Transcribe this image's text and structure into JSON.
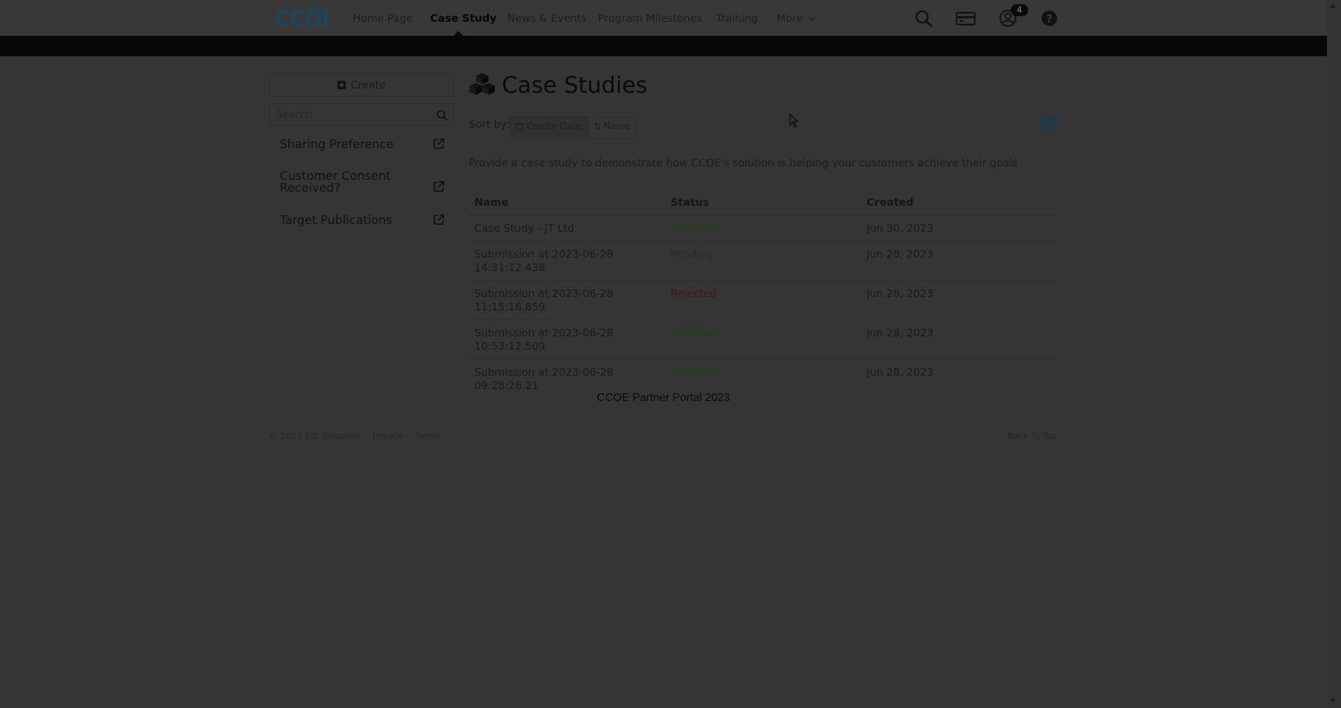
{
  "nav": {
    "logo_text": "CCOE",
    "items": [
      {
        "label": "Home Page"
      },
      {
        "label": "Case Study"
      },
      {
        "label": "News & Events"
      },
      {
        "label": "Program Milestones"
      },
      {
        "label": "Training"
      },
      {
        "label": "More"
      }
    ],
    "active_index": 1,
    "notification_count": "4",
    "icons": [
      "search-icon",
      "card-icon",
      "user-icon",
      "help-icon"
    ]
  },
  "sidebar": {
    "create_label": "Create",
    "search_placeholder": "Search",
    "links": [
      {
        "label": "Sharing Preference"
      },
      {
        "label": "Customer Consent Received?"
      },
      {
        "label": "Target Publications"
      }
    ]
  },
  "main": {
    "title": "Case Studies",
    "sort_label": "Sort by:",
    "sort_options": [
      {
        "label": "Create Date",
        "icon": "calendar-icon"
      },
      {
        "label": "Name",
        "icon": "sort-icon"
      }
    ],
    "sort_active": "Create Date",
    "description": "Provide a case study to demonstrate how CCOE's solution is helping your customers achieve their goals",
    "table": {
      "headers": [
        "Name",
        "Status",
        "Created"
      ],
      "rows": [
        {
          "name": "Case Study - JT Ltd",
          "status": "Approved",
          "created": "Jun 30, 2023"
        },
        {
          "name": "Submission at 2023-06-28 14:31:12.438",
          "status": "Pending",
          "created": "Jun 28, 2023"
        },
        {
          "name": "Submission at 2023-06-28 11:15:16.859",
          "status": "Rejected",
          "created": "Jun 28, 2023"
        },
        {
          "name": "Submission at 2023-06-28 10:53:12.509",
          "status": "Approved",
          "created": "Jun 28, 2023"
        },
        {
          "name": "Submission at 2023-06-28 09:28:26.21",
          "status": "Approved",
          "created": "Jun 28, 2023"
        }
      ]
    }
  },
  "footer": {
    "center_text": "CCOE Partner Portal 2023",
    "copyright": "© 2023 Zift Solutions",
    "privacy": "Privacy",
    "terms": "Terms",
    "back_to_top": "Back To Top"
  },
  "colors": {
    "overlay_background": "#353535",
    "status_approved": "#1f3d14",
    "status_rejected": "#4a1313",
    "logo_blue": "#1c4660"
  }
}
